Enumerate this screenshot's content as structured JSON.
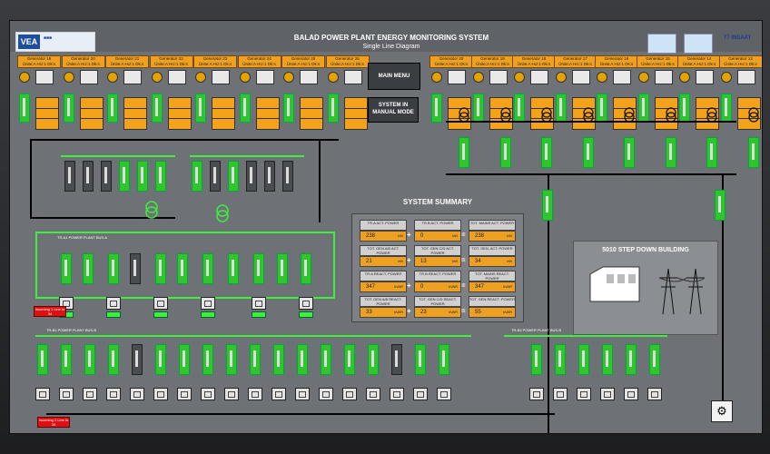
{
  "header": {
    "title": "BALAD POWER PLANT ENERGY MONITORING SYSTEM",
    "subtitle": "Single Line Diagram",
    "logo_left_mark": "VEA",
    "logo_right_text": "77 INSAAT"
  },
  "buttons": {
    "main_menu": "MAIN MENU",
    "manual_mode": "SYSTEM IN MANUAL MODE"
  },
  "generators_left": [
    {
      "label": "Generator 19",
      "sub": "Ünite:A  Hız:1 Dk:s"
    },
    {
      "label": "Generator 20",
      "sub": "Ünite:A  Hız:1 Dk:s"
    },
    {
      "label": "Generator 21",
      "sub": "Ünite:A  Hız:1 Dk:s"
    },
    {
      "label": "Generator 22",
      "sub": "Ünite:A  Hız:1 Dk:s"
    },
    {
      "label": "Generator 23",
      "sub": "Ünite:A  Hız:1 Dk:s"
    },
    {
      "label": "Generator 24",
      "sub": "Ünite:A  Hız:1 Dk:s"
    },
    {
      "label": "Generator 25",
      "sub": "Ünite:A  Hız:1 Dk:s"
    },
    {
      "label": "Generator 26",
      "sub": "Ünite:A  Hız:1 Dk:s"
    }
  ],
  "generators_right": [
    {
      "label": "Generator 20",
      "sub": "Ünite:A  Hız:1 Dk:s"
    },
    {
      "label": "Generator 19",
      "sub": "Ünite:A  Hız:1 Dk:s"
    },
    {
      "label": "Generator 18",
      "sub": "Ünite:A  Hız:1 Dk:s"
    },
    {
      "label": "Generator 17",
      "sub": "Ünite:A  Hız:1 Dk:s"
    },
    {
      "label": "Generator 16",
      "sub": "Ünite:A  Hız:1 Dk:s"
    },
    {
      "label": "Generator 15",
      "sub": "Ünite:A  Hız:1 Dk:s"
    },
    {
      "label": "Generator 14",
      "sub": "Ünite:A  Hız:1 Dk:s"
    },
    {
      "label": "Generator 13",
      "sub": "Ünite:A  Hız:1 Dk:s"
    }
  ],
  "summary": {
    "title": "SYSTEM SUMMARY",
    "rows": [
      {
        "l1": "TR.A ACT. POWER",
        "v1": "238",
        "u1": "kW",
        "l2": "TR.B ACT. POWER",
        "v2": "0",
        "u2": "kW",
        "l3": "TOT. MAINS ACT. POWER",
        "v3": "238",
        "u3": "kW"
      },
      {
        "l1": "TOT. GEN A/B ACT. POWER",
        "v1": "21",
        "u1": "kW",
        "l2": "TOT. GEN C/D ACT. POWER",
        "v2": "13",
        "u2": "kW",
        "l3": "TOT. GEN. ACT. POWER",
        "v3": "34",
        "u3": "kW"
      },
      {
        "l1": "TR.A REACT. POWER",
        "v1": "347",
        "u1": "kVAR",
        "l2": "TR.B REACT. POWER",
        "v2": "0",
        "u2": "kVAR",
        "l3": "TOT. MAINS REACT. POWER",
        "v3": "347",
        "u3": "kVAR"
      },
      {
        "l1": "TOT. GEN A/B REACT. POWER",
        "v1": "33",
        "u1": "kVAR",
        "l2": "TOT. GEN C/D REACT. POWER",
        "v2": "23",
        "u2": "kVAR",
        "l3": "TOT. GEN REACT. POWER",
        "v3": "55",
        "u3": "kVAR"
      }
    ],
    "ops": [
      "+",
      "=",
      "+",
      "=",
      "+",
      "=",
      "+",
      "="
    ]
  },
  "step_down": {
    "title": "5010 STEP DOWN BUILDING"
  },
  "tags": {
    "bus_label_1": "TR-A1 POWER PLANT BUS-A",
    "bus_label_2": "TR-B1 POWER PLANT BUS-B",
    "bus_label_3": "TR-B2 POWER PLANT BUS-B",
    "red_tag_1": "Incoming 1 Line to 34",
    "red_tag_2": "Incoming 2 Line to 34"
  },
  "colors": {
    "energized": "#3df03d",
    "deenergized": "#000000",
    "value_bg": "#f0a020",
    "screen_bg": "#6e7176"
  }
}
